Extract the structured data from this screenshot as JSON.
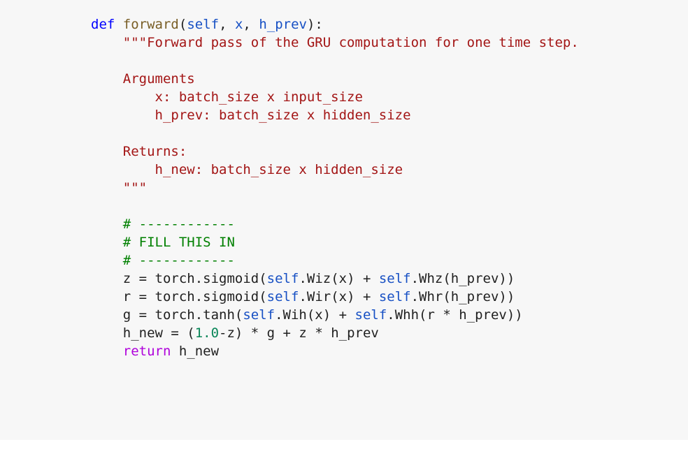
{
  "code": {
    "lines": [
      [
        {
          "t": "def",
          "c": "kw-def"
        },
        {
          "t": " "
        },
        {
          "t": "forward",
          "c": "kw-fn"
        },
        {
          "t": "("
        },
        {
          "t": "self",
          "c": "kw-self"
        },
        {
          "t": ", "
        },
        {
          "t": "x",
          "c": "kw-self"
        },
        {
          "t": ", "
        },
        {
          "t": "h_prev",
          "c": "kw-self"
        },
        {
          "t": "):"
        }
      ],
      [
        {
          "t": "    "
        },
        {
          "t": "\"\"\"Forward pass of the GRU computation for one time step.",
          "c": "str"
        }
      ],
      [
        {
          "t": ""
        }
      ],
      [
        {
          "t": "    "
        },
        {
          "t": "Arguments",
          "c": "str"
        }
      ],
      [
        {
          "t": "        "
        },
        {
          "t": "x: batch_size x input_size",
          "c": "str"
        }
      ],
      [
        {
          "t": "        "
        },
        {
          "t": "h_prev: batch_size x hidden_size",
          "c": "str"
        }
      ],
      [
        {
          "t": ""
        }
      ],
      [
        {
          "t": "    "
        },
        {
          "t": "Returns:",
          "c": "str"
        }
      ],
      [
        {
          "t": "        "
        },
        {
          "t": "h_new: batch_size x hidden_size",
          "c": "str"
        }
      ],
      [
        {
          "t": "    "
        },
        {
          "t": "\"\"\"",
          "c": "str"
        }
      ],
      [
        {
          "t": ""
        }
      ],
      [
        {
          "t": "    "
        },
        {
          "t": "# ------------",
          "c": "com"
        }
      ],
      [
        {
          "t": "    "
        },
        {
          "t": "# FILL THIS IN",
          "c": "com"
        }
      ],
      [
        {
          "t": "    "
        },
        {
          "t": "# ------------",
          "c": "com"
        }
      ],
      [
        {
          "t": "    z = torch.sigmoid("
        },
        {
          "t": "self",
          "c": "kw-self"
        },
        {
          "t": ".Wiz(x) + "
        },
        {
          "t": "self",
          "c": "kw-self"
        },
        {
          "t": ".Whz(h_prev))"
        }
      ],
      [
        {
          "t": "    r = torch.sigmoid("
        },
        {
          "t": "self",
          "c": "kw-self"
        },
        {
          "t": ".Wir(x) + "
        },
        {
          "t": "self",
          "c": "kw-self"
        },
        {
          "t": ".Whr(h_prev))"
        }
      ],
      [
        {
          "t": "    g = torch.tanh("
        },
        {
          "t": "self",
          "c": "kw-self"
        },
        {
          "t": ".Wih(x) + "
        },
        {
          "t": "self",
          "c": "kw-self"
        },
        {
          "t": ".Whh(r * h_prev))"
        }
      ],
      [
        {
          "t": "    h_new = ("
        },
        {
          "t": "1.0",
          "c": "num"
        },
        {
          "t": "-z) * g + z * h_prev"
        }
      ],
      [
        {
          "t": "    "
        },
        {
          "t": "return",
          "c": "kw-return"
        },
        {
          "t": " h_new"
        }
      ]
    ]
  }
}
